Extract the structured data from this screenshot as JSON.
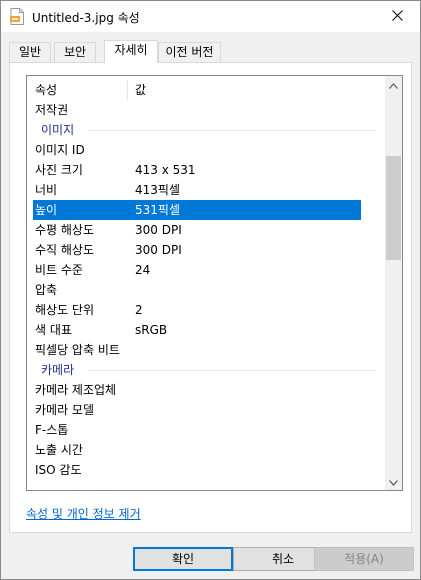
{
  "window": {
    "title": "Untitled-3.jpg 속성"
  },
  "tabs": [
    {
      "label": "일반"
    },
    {
      "label": "보안"
    },
    {
      "label": "자세히"
    },
    {
      "label": "이전 버전"
    }
  ],
  "list": {
    "header": {
      "name": "속성",
      "value": "값"
    },
    "rows": [
      {
        "name": "저작권",
        "value": ""
      },
      {
        "group": "이미지"
      },
      {
        "name": "이미지 ID",
        "value": ""
      },
      {
        "name": "사진 크기",
        "value": "413 x 531"
      },
      {
        "name": "너비",
        "value": "413픽셀"
      },
      {
        "name": "높이",
        "value": "531픽셀",
        "selected": true
      },
      {
        "name": "수평 해상도",
        "value": "300 DPI"
      },
      {
        "name": "수직 해상도",
        "value": "300 DPI"
      },
      {
        "name": "비트 수준",
        "value": "24"
      },
      {
        "name": "압축",
        "value": ""
      },
      {
        "name": "해상도 단위",
        "value": "2"
      },
      {
        "name": "색 대표",
        "value": "sRGB"
      },
      {
        "name": "픽셀당 압축 비트",
        "value": ""
      },
      {
        "group": "카메라"
      },
      {
        "name": "카메라 제조업체",
        "value": ""
      },
      {
        "name": "카메라 모델",
        "value": ""
      },
      {
        "name": "F-스톱",
        "value": ""
      },
      {
        "name": "노출 시간",
        "value": ""
      },
      {
        "name": "ISO 감도",
        "value": ""
      }
    ]
  },
  "link": {
    "label": "속성 및 개인 정보 제거"
  },
  "buttons": {
    "ok": "확인",
    "cancel": "취소",
    "apply": "적용(A)"
  },
  "colors": {
    "selection": "#0078d7",
    "link": "#0066cc",
    "group": "#1e3287"
  }
}
